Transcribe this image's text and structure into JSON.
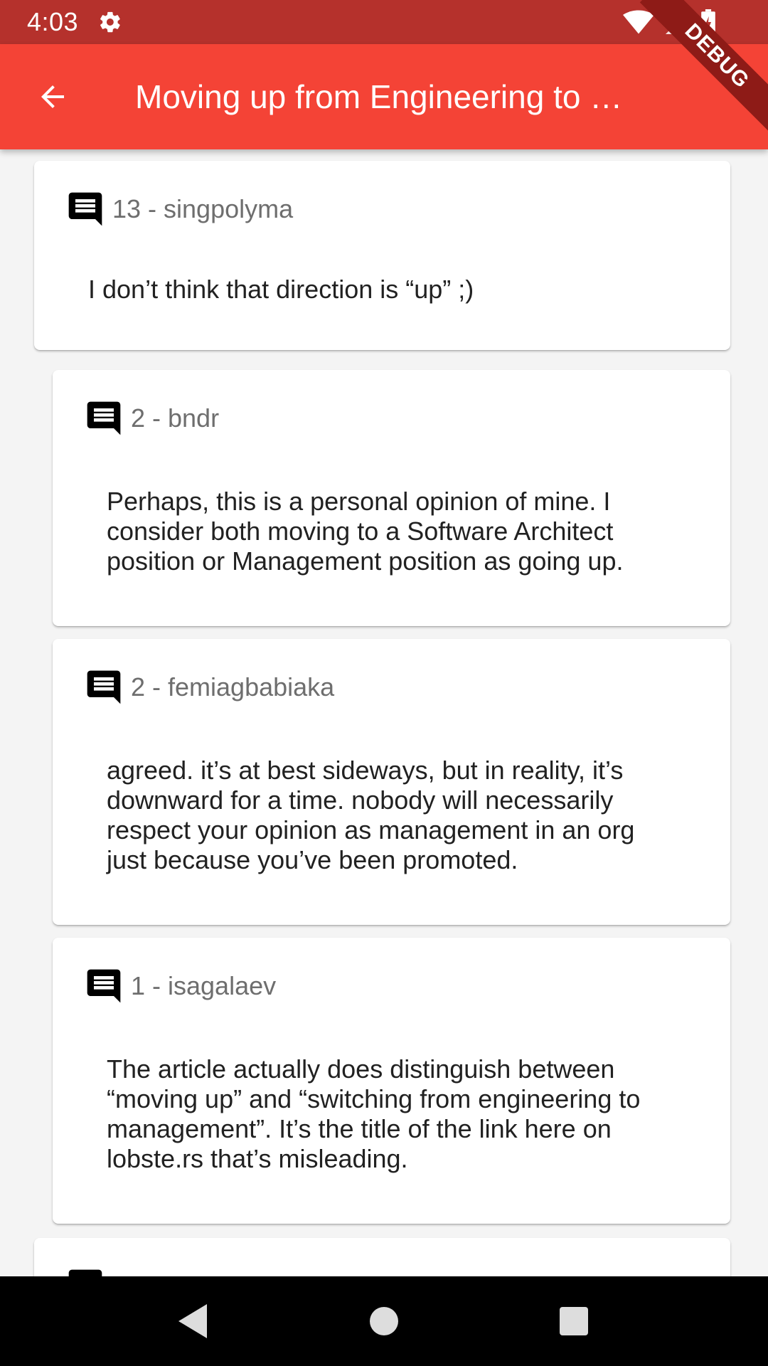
{
  "status_bar": {
    "time": "4:03",
    "icons": [
      "settings-icon",
      "wifi-icon",
      "signal-icon",
      "battery-icon"
    ]
  },
  "app_bar": {
    "title": "Moving up from Engineering to …",
    "back_icon": "arrow-back-icon",
    "color": "#f44336"
  },
  "debug_banner": "DEBUG",
  "comments": [
    {
      "meta": "13 - singpolyma",
      "text": "I don’t think that direction is “up” ;)"
    },
    {
      "meta": "2 - bndr",
      "text": "Perhaps, this is a personal opinion of mine. I consider both moving to a Software Architect position or Management position as going up."
    },
    {
      "meta": "2 - femiagbabiaka",
      "text": "agreed. it’s at best sideways, but in reality, it’s downward for a time. nobody will necessarily respect your opinion as management in an org just because you’ve been promoted."
    },
    {
      "meta": "1 - isagalaev",
      "text": "The article actually does distinguish between “moving up” and “switching from engineering to management”. It’s the title of the link here on lobste.rs that’s misleading."
    }
  ],
  "nav_bar": {
    "icons": [
      "back-triangle-icon",
      "home-circle-icon",
      "recents-square-icon"
    ]
  }
}
